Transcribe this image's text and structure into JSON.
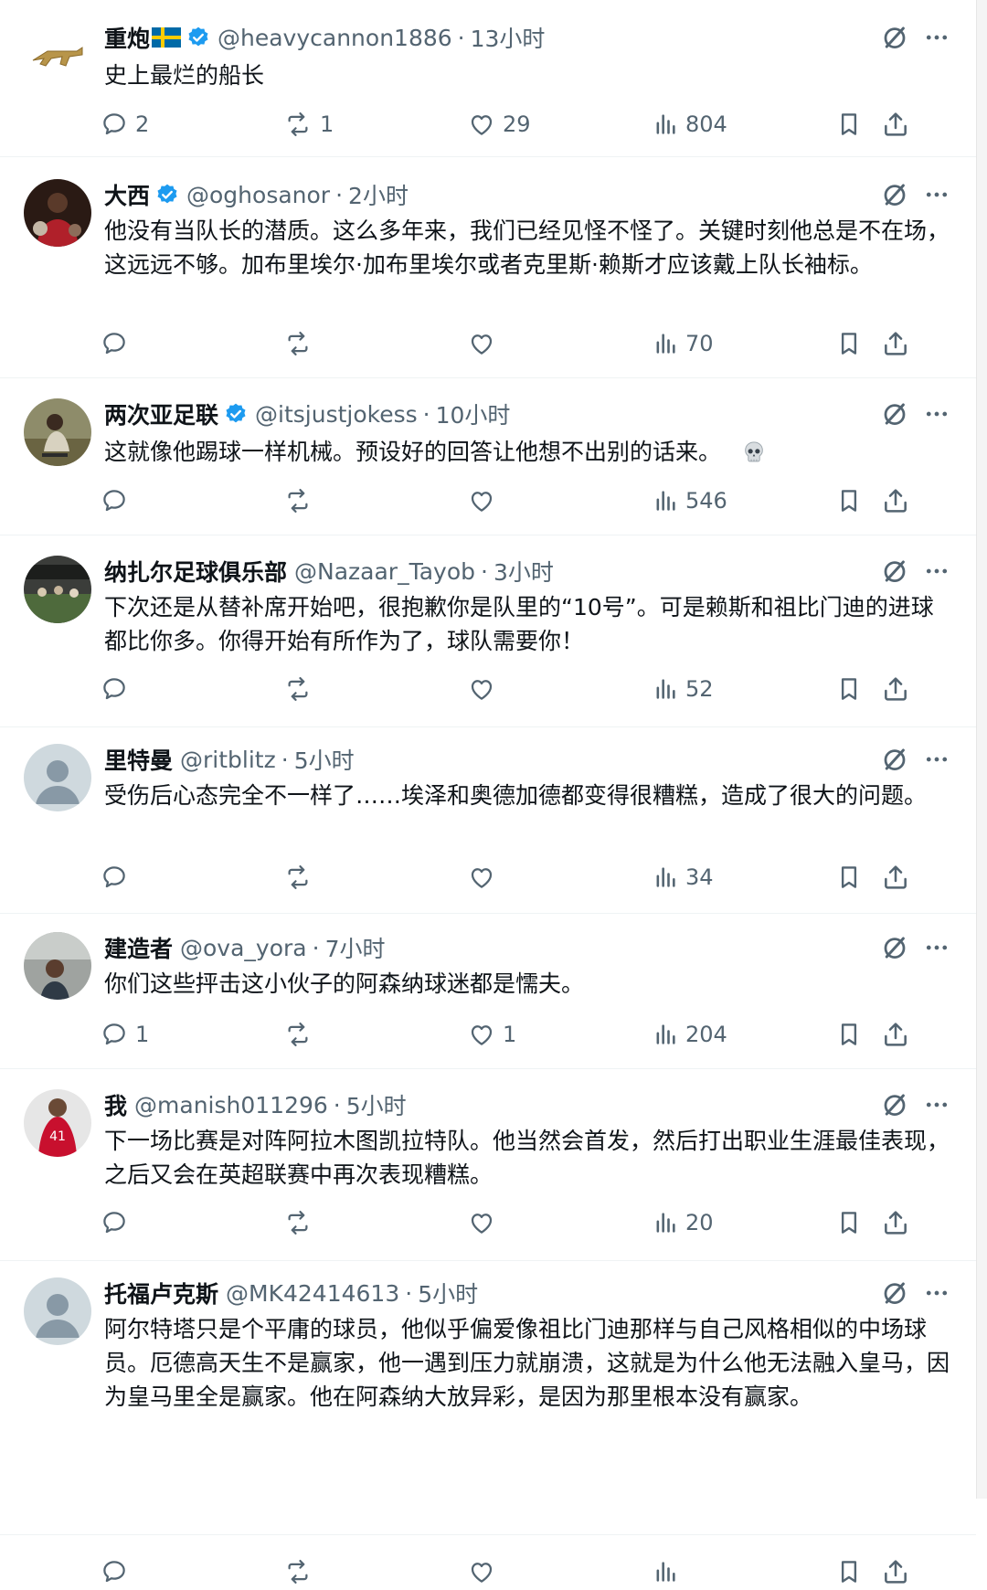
{
  "colors": {
    "text": "#0f1419",
    "secondary": "#536471",
    "verified": "#1d9bf0",
    "divider": "#eff3f4"
  },
  "posts": [
    {
      "name": "重炮",
      "flag": "sweden-flag",
      "verified": true,
      "handle": "@heavycannon1886",
      "time": "13小时",
      "text": "史上最烂的船长",
      "replies": "2",
      "reposts": "1",
      "likes": "29",
      "views": "804"
    },
    {
      "name": "大西",
      "verified": true,
      "handle": "@oghosanor",
      "time": "2小时",
      "text": "他没有当队长的潜质。这么多年来，我们已经见怪不怪了。关键时刻他总是不在场，这远远不够。加布里埃尔·加布里埃尔或者克里斯·赖斯才应该戴上队长袖标。",
      "replies": "",
      "reposts": "",
      "likes": "",
      "views": "70"
    },
    {
      "name": "两次亚足联",
      "verified": true,
      "handle": "@itsjustjokess",
      "time": "10小时",
      "text": "这就像他踢球一样机械。预设好的回答让他想不出别的话来。",
      "emoji": "skull-emoji",
      "replies": "",
      "reposts": "",
      "likes": "",
      "views": "546"
    },
    {
      "name": "纳扎尔足球俱乐部",
      "verified": false,
      "handle": "@Nazaar_Tayob",
      "time": "3小时",
      "text": "下次还是从替补席开始吧，很抱歉你是队里的“10号”。可是赖斯和祖比门迪的进球都比你多。你得开始有所作为了，球队需要你！",
      "replies": "",
      "reposts": "",
      "likes": "",
      "views": "52"
    },
    {
      "name": "里特曼",
      "verified": false,
      "handle": "@ritblitz",
      "time": "5小时",
      "text": "受伤后心态完全不一样了……埃泽和奥德加德都变得很糟糕，造成了很大的问题。",
      "replies": "",
      "reposts": "",
      "likes": "",
      "views": "34"
    },
    {
      "name": "建造者",
      "verified": false,
      "handle": "@ova_yora",
      "time": "7小时",
      "text": "你们这些抨击这小伙子的阿森纳球迷都是懦夫。",
      "replies": "1",
      "reposts": "",
      "likes": "1",
      "views": "204"
    },
    {
      "name": "我",
      "verified": false,
      "handle": "@manish011296",
      "time": "5小时",
      "text": "下一场比赛是对阵阿拉木图凯拉特队。他当然会首发，然后打出职业生涯最佳表现，之后又会在英超联赛中再次表现糟糕。",
      "replies": "",
      "reposts": "",
      "likes": "",
      "views": "20"
    },
    {
      "name": "托福卢克斯",
      "verified": false,
      "handle": "@MK42414613",
      "time": "5小时",
      "text": "阿尔特塔只是个平庸的球员，他似乎偏爱像祖比门迪那样与自己风格相似的中场球员。厄德高天生不是赢家，他一遇到压力就崩溃，这就是为什么他无法融入皇马，因为皇马里全是赢家。他在阿森纳大放异彩，是因为那里根本没有赢家。",
      "replies": "",
      "reposts": "",
      "likes": "",
      "views": ""
    }
  ]
}
